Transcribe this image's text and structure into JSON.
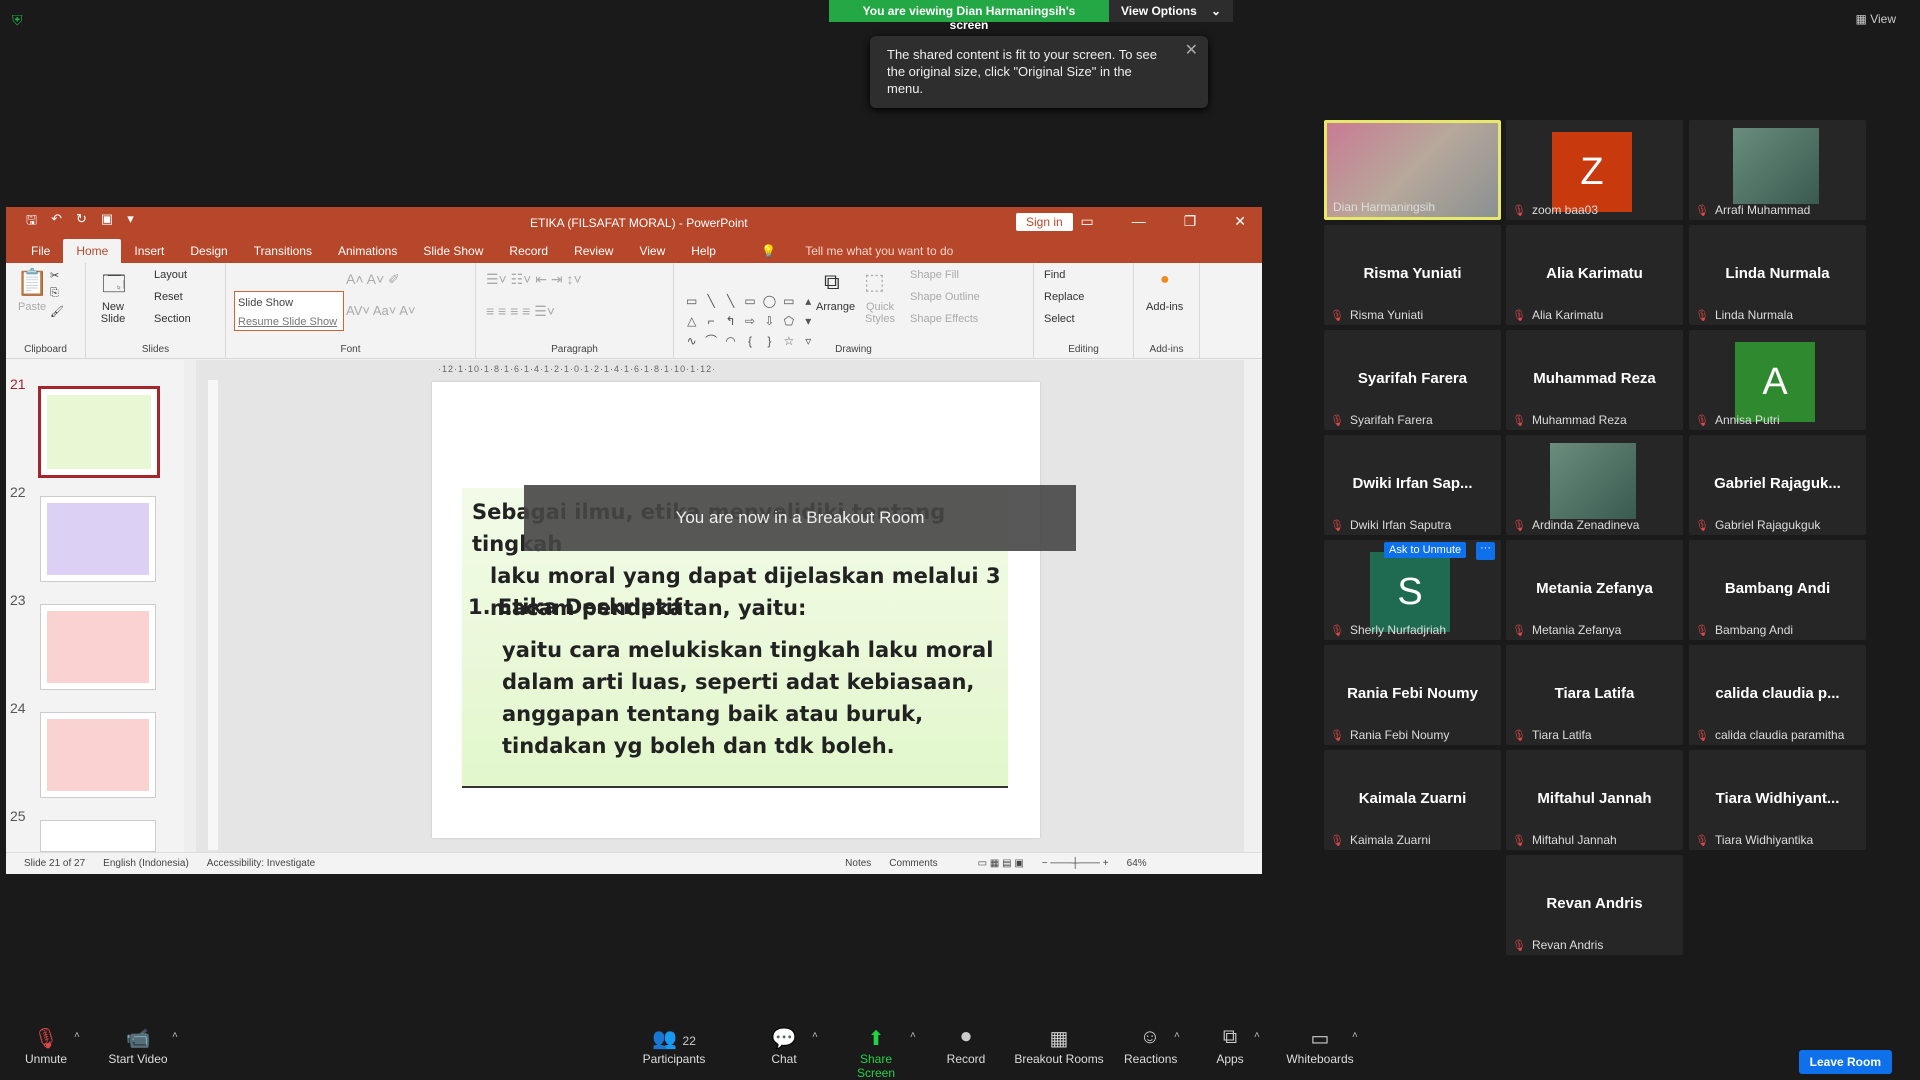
{
  "banner": {
    "viewing": "You are viewing Dian Harmaningsih's screen",
    "view_options": "View Options",
    "view_right": "View"
  },
  "tooltip": {
    "text": "The shared content is fit to your screen. To see the original size, click \"Original Size\" in the menu."
  },
  "ppt": {
    "title": "ETIKA  (FILSAFAT MORAL)  -  PowerPoint",
    "sign_in": "Sign in",
    "tabs": [
      "File",
      "Home",
      "Insert",
      "Design",
      "Transitions",
      "Animations",
      "Slide Show",
      "Record",
      "Review",
      "View",
      "Help"
    ],
    "tell_me": "Tell me what you want to do",
    "ribbon": {
      "clipboard": "Clipboard",
      "paste": "Paste",
      "new_slide": "New Slide",
      "layout": "Layout",
      "reset": "Reset",
      "section": "Section",
      "slides": "Slides",
      "slide_show": "Slide Show",
      "resume": "Resume Slide Show",
      "font": "Font",
      "paragraph": "Paragraph",
      "arrange": "Arrange",
      "quick_styles": "Quick Styles",
      "shape_fill": "Shape Fill",
      "shape_outline": "Shape Outline",
      "shape_effects": "Shape Effects",
      "drawing": "Drawing",
      "find": "Find",
      "replace": "Replace",
      "select": "Select",
      "editing": "Editing",
      "addins": "Add-ins",
      "addins_group": "Add-ins"
    },
    "thumb_numbers": [
      "21",
      "22",
      "23",
      "24",
      "25"
    ],
    "ruler": "·12·1·10·1·8·1·6·1·4·1·2·1·0·1·2·1·4·1·6·1·8·1·10·1·12·",
    "slide": {
      "para1_first": "Sebagai ilmu, etika menyelidiki tentang tingkah",
      "para1_rest": "laku moral yang dapat dijelaskan melalui 3 macam pendekatan, yaitu:",
      "heading": "1.  Etika Deskriptif",
      "para2": "yaitu cara melukiskan tingkah laku moral dalam arti luas, seperti adat kebiasaan, anggapan tentang baik atau buruk, tindakan yg boleh dan tdk boleh."
    },
    "breakout": "You are now in a Breakout Room",
    "status": {
      "slide": "Slide 21 of 27",
      "language": "English (Indonesia)",
      "accessibility": "Accessibility: Investigate",
      "notes": "Notes",
      "comments": "Comments",
      "zoom": "64%"
    }
  },
  "participants": [
    {
      "big": "",
      "name": "Dian Harmaningsih",
      "photo": true,
      "active": true,
      "muted": false
    },
    {
      "big": "Z",
      "name": "zoom baa03",
      "avatar": "#c8390e"
    },
    {
      "big": "",
      "name": "Arrafi Muhammad",
      "photo": true
    },
    {
      "big": "Risma Yuniati",
      "name": "Risma Yuniati"
    },
    {
      "big": "Alia Karimatu",
      "name": "Alia Karimatu"
    },
    {
      "big": "Linda Nurmala",
      "name": "Linda Nurmala"
    },
    {
      "big": "Syarifah Farera",
      "name": "Syarifah Farera"
    },
    {
      "big": "Muhammad Reza",
      "name": "Muhammad Reza"
    },
    {
      "big": "A",
      "name": "Annisa Putri",
      "avatar": "#2f8a2f"
    },
    {
      "big": "Dwiki  Irfan  Sap...",
      "name": "Dwiki Irfan Saputra"
    },
    {
      "big": "",
      "name": "Ardinda Zenadineva",
      "photo": true
    },
    {
      "big": "Gabriel  Rajaguk...",
      "name": "Gabriel Rajagukguk"
    },
    {
      "big": "S",
      "name": "Sherly Nurfadjriah",
      "avatar": "#1f6b52",
      "ask": "Ask to Unmute",
      "more": "···"
    },
    {
      "big": "Metania Zefanya",
      "name": "Metania Zefanya"
    },
    {
      "big": "Bambang Andi",
      "name": "Bambang Andi"
    },
    {
      "big": "Rania Febi Noumy",
      "name": "Rania Febi Noumy"
    },
    {
      "big": "Tiara Latifa",
      "name": "Tiara Latifa"
    },
    {
      "big": "calida  claudia  p...",
      "name": "calida claudia paramitha"
    },
    {
      "big": "Kaimala Zuarni",
      "name": "Kaimala Zuarni"
    },
    {
      "big": "Miftahul Jannah",
      "name": "Miftahul Jannah"
    },
    {
      "big": "Tiara  Widhiyant...",
      "name": "Tiara Widhiyantika"
    },
    {
      "big": "Revan Andris",
      "name": "Revan Andris"
    }
  ],
  "toolbar": {
    "unmute": "Unmute",
    "start_video": "Start Video",
    "participants": "Participants",
    "participants_count": "22",
    "chat": "Chat",
    "share": "Share Screen",
    "record": "Record",
    "breakout": "Breakout Rooms",
    "reactions": "Reactions",
    "apps": "Apps",
    "whiteboards": "Whiteboards",
    "leave": "Leave Room"
  }
}
